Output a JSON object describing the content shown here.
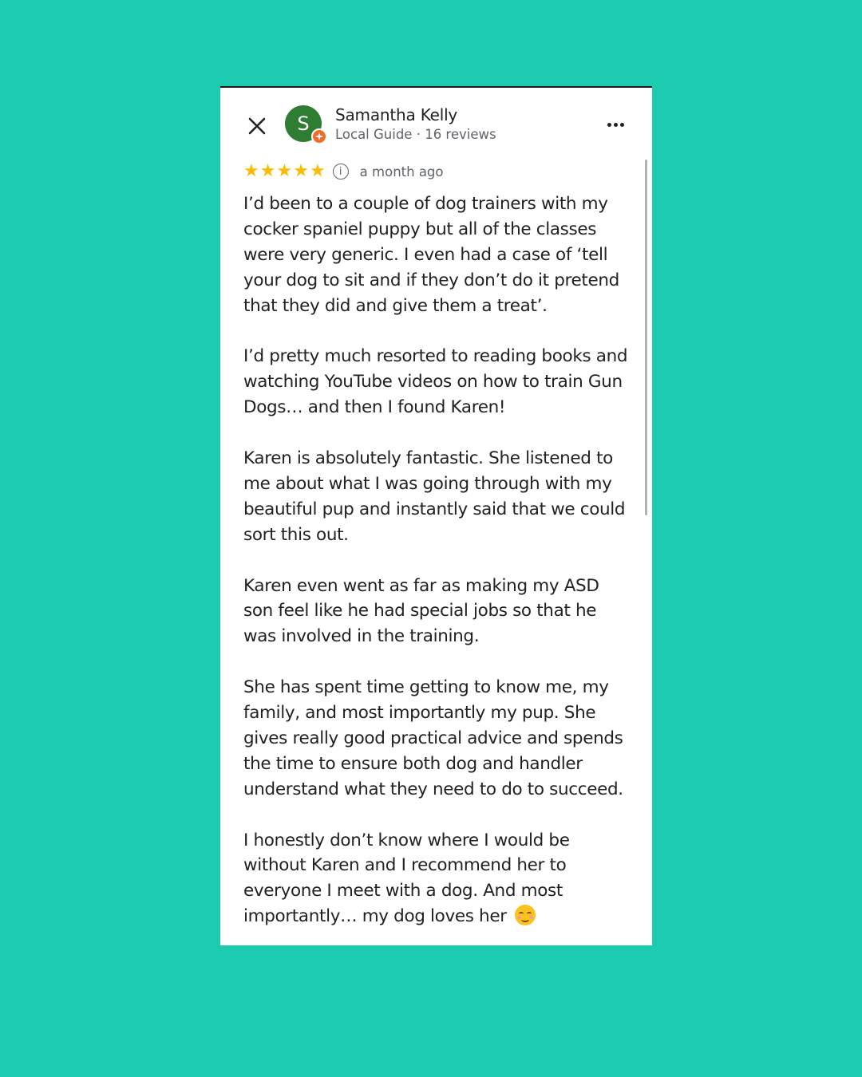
{
  "author": {
    "avatar_initial": "S",
    "name": "Samantha Kelly",
    "meta": "Local Guide · 16 reviews"
  },
  "rating": {
    "stars": 5,
    "max_stars": 5,
    "date": "a month ago"
  },
  "review": {
    "paragraphs": [
      "I’d been to a couple of dog trainers with my cocker spaniel puppy but all of the classes were very generic. I even had a case of ‘tell your dog to sit and if they don’t do it pretend that they did and give them a treat’.",
      "I’d pretty much resorted to reading books and watching YouTube videos on how to train Gun Dogs… and then I found Karen!",
      "Karen is absolutely fantastic. She listened to me about what I was going through with my beautiful pup and instantly said that we could sort this out.",
      "Karen even went as far as making my ASD son feel like he had special jobs so that he was involved in the training.",
      "She has spent time getting to know me, my family, and most importantly my pup. She gives really good practical advice and spends the time to ensure both dog and handler understand what they need to do to succeed.",
      "I honestly don’t know where I would be without Karen and I recommend her to everyone I meet with a dog. And most importantly… my dog loves her"
    ],
    "trailing_emoji": "smiling-face-icon"
  },
  "icons": {
    "close": "close-icon",
    "more": "more-options-icon",
    "info": "info-icon",
    "badge": "local-guide-badge-icon",
    "star": "star-icon"
  },
  "colors": {
    "background": "#1ccbb0",
    "card": "#ffffff",
    "avatar": "#2e7d32",
    "badge": "#f06b28",
    "star": "#fbbc04",
    "text": "#202124",
    "secondary_text": "#5f6368"
  }
}
